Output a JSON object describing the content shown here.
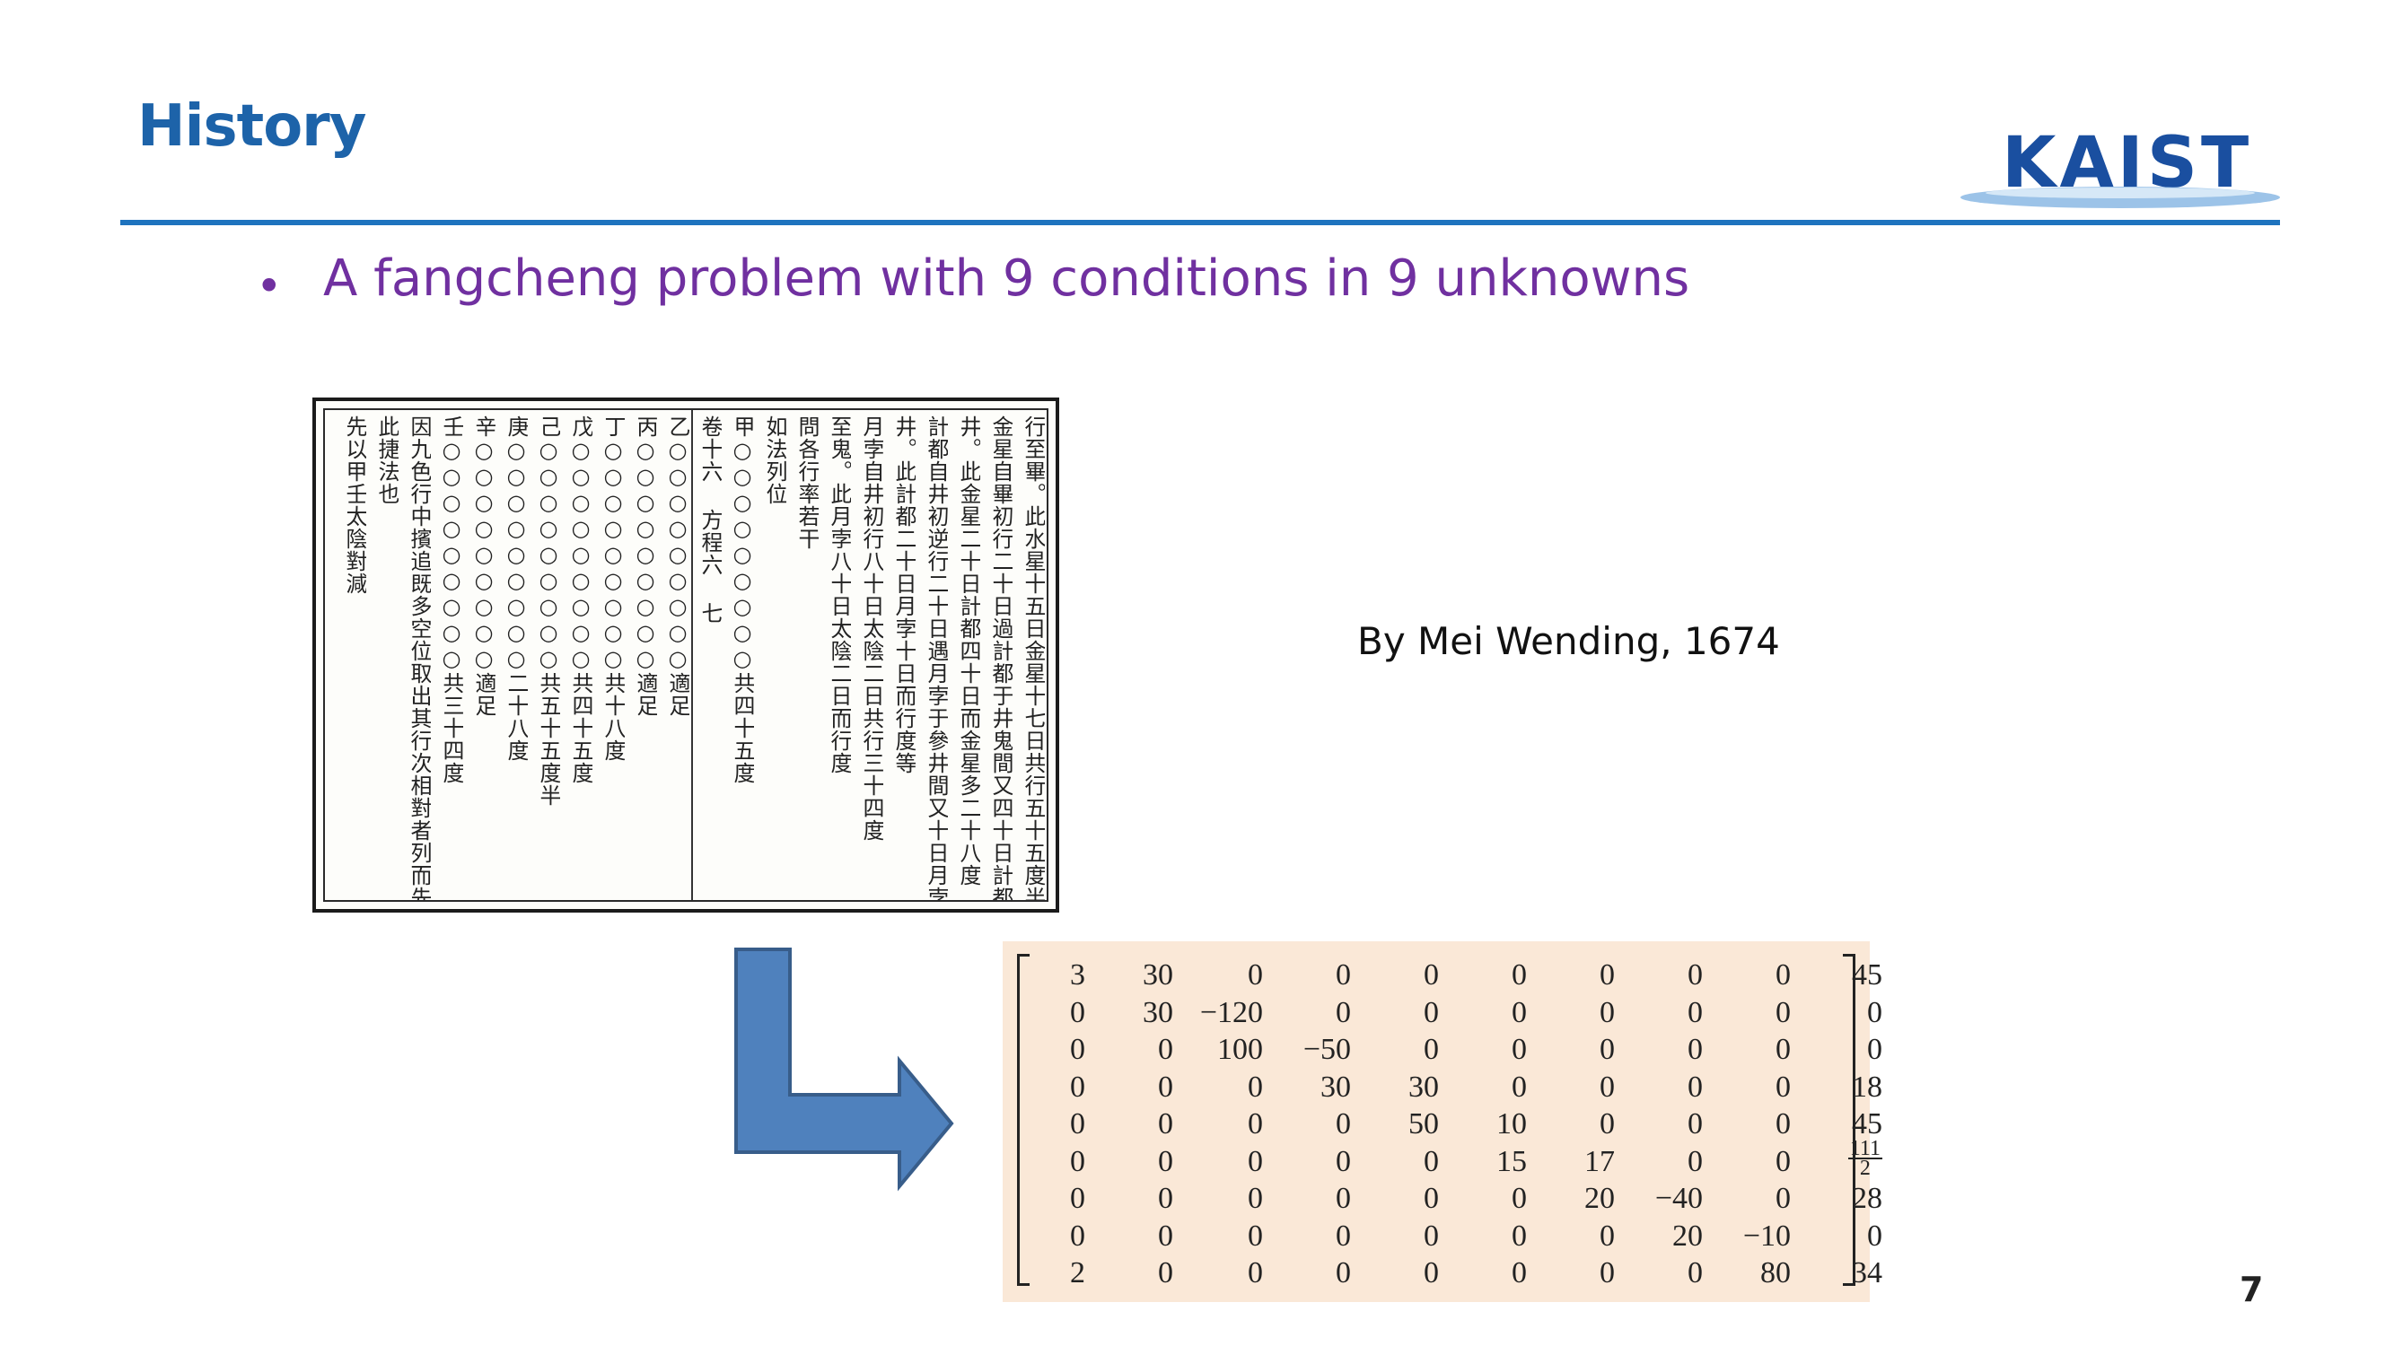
{
  "slide": {
    "title": "History",
    "bullet": "A fangcheng problem with 9 conditions in 9 unknowns",
    "attribution": "By Mei Wending, 1674",
    "page_number": "7"
  },
  "logo": {
    "text": "KAIST"
  },
  "manuscript": {
    "columns": [
      "行至畢。此水星十五日金星十七日共行五十五度半",
      "金星自畢初行二十日過計都于井鬼間又四十日計都退至",
      "井。此金星二十日計都四十日而金星多二十八度",
      "計都自井初逆行二十日遇月孛于參井間又十日月孛行至",
      "井。此計都二十日月孛十日而行度等",
      "月孛自井初行八十日太陰二日共行三十四度",
      "至鬼。此月孛八十日太陰二日而行度",
      "問各行率若干",
      "如法列位",
      "甲○○○○○○○○○共四十五度",
      "卷十六 方程六 七",
      "乙○○○○○○○○○適足",
      "丙○○○○○○○○○適足",
      "丁○○○○○○○○○共十八度",
      "戊○○○○○○○○○共四十五度",
      "己○○○○○○○○○共五十五度半",
      "庚○○○○○○○○○二十八度",
      "辛○○○○○○○○○適足",
      "壬○○○○○○○○○共三十四度",
      "因九色行中擯追既多空位取出其行次相對者列而先乘",
      "此捷法也",
      "先以甲壬太陰對減"
    ]
  },
  "matrix": {
    "rows": [
      [
        "3",
        "30",
        "0",
        "0",
        "0",
        "0",
        "0",
        "0",
        "0",
        "45"
      ],
      [
        "0",
        "30",
        "−120",
        "0",
        "0",
        "0",
        "0",
        "0",
        "0",
        "0"
      ],
      [
        "0",
        "0",
        "100",
        "−50",
        "0",
        "0",
        "0",
        "0",
        "0",
        "0"
      ],
      [
        "0",
        "0",
        "0",
        "30",
        "30",
        "0",
        "0",
        "0",
        "0",
        "18"
      ],
      [
        "0",
        "0",
        "0",
        "0",
        "50",
        "10",
        "0",
        "0",
        "0",
        "45"
      ],
      [
        "0",
        "0",
        "0",
        "0",
        "0",
        "15",
        "17",
        "0",
        "0",
        "111/2"
      ],
      [
        "0",
        "0",
        "0",
        "0",
        "0",
        "0",
        "20",
        "−40",
        "0",
        "28"
      ],
      [
        "0",
        "0",
        "0",
        "0",
        "0",
        "0",
        "0",
        "20",
        "−10",
        "0"
      ],
      [
        "2",
        "0",
        "0",
        "0",
        "0",
        "0",
        "0",
        "0",
        "80",
        "34"
      ]
    ]
  },
  "colors": {
    "title": "#1d63a9",
    "rule": "#1e73be",
    "bullet": "#7030a0",
    "arrow_fill": "#4f81bd",
    "arrow_stroke": "#385d8a",
    "matrix_background": "#fae8d7"
  }
}
